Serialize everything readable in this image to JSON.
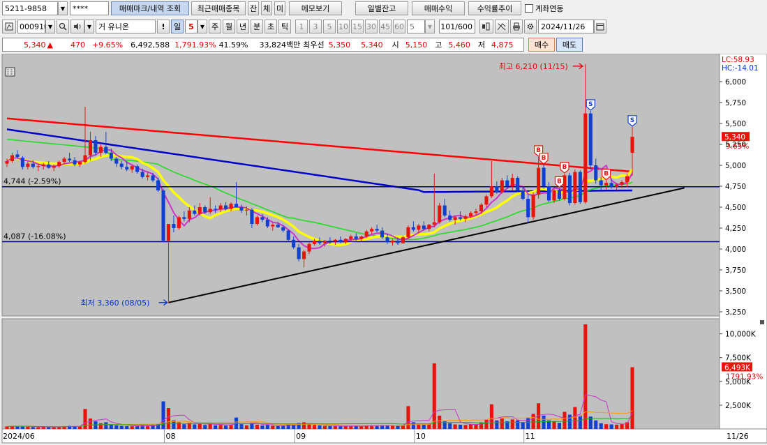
{
  "toolbar1": {
    "account": "5211-9858",
    "password": "****",
    "trade_mark_btn": "매매마크/내역 조회",
    "recent_items_btn": "최근매매종목",
    "btn_jan": "잔",
    "btn_che": "체",
    "btn_mi": "미",
    "memo_btn": "메모보기",
    "daily_balance_btn": "일별잔고",
    "trade_profit_btn": "매매수익",
    "return_trend_btn": "수익률추이",
    "account_link_label": "계좌연동"
  },
  "toolbar2": {
    "code": "000910",
    "market": "거",
    "name": "유니온",
    "period_buttons": [
      "일",
      "5",
      "주",
      "월",
      "년",
      "분",
      "초",
      "틱"
    ],
    "interval_buttons": [
      "1",
      "3",
      "5",
      "10",
      "15",
      "30",
      "45",
      "60"
    ],
    "interval_select": "5",
    "count": "101",
    "count_total": "/600",
    "date": "2024/11/26"
  },
  "quote": {
    "price": "5,340",
    "arrow": "▲",
    "change": "470",
    "change_pct": "+9.65%",
    "volume": "6,492,588",
    "volume_pct": "1,791.93%",
    "turnover": "41.59%",
    "amount": "33,824백만",
    "priority_label": "최우선",
    "ask": "5,350",
    "bid": "5,340",
    "open_label": "시",
    "open": "5,150",
    "high_label": "고",
    "high": "5,460",
    "low_label": "저",
    "low": "4,875",
    "buy_btn": "매수",
    "sell_btn": "매도"
  },
  "chart_labels": {
    "max_label": "최고 6,210 (11/15)",
    "min_label": "최저 3,360 (08/05)",
    "hline1": "4,744 (-2.59%)",
    "hline2": "4,087 (-16.08%)",
    "lc": "LC:58.93",
    "hc": "HC:-14.01",
    "cur_price_tag": "5,340",
    "cur_pct_tag": "9.65%",
    "vol_tag": "6,493K",
    "vol_pct_tag": "1791.93%",
    "x_end": "11/26"
  },
  "colors": {
    "up": "#e8140c",
    "down": "#1040d0",
    "ma_red": "#ff0000",
    "ma_blue": "#0000cc",
    "ma_green": "#22dd22",
    "ma_yellow": "#ffff00",
    "ma_magenta": "#cc33cc",
    "chart_bg": "#c0c0c0"
  },
  "chart_data": {
    "type": "candlestick",
    "title": "",
    "price_axis": [
      6000,
      5750,
      5500,
      5250,
      5000,
      4750,
      4500,
      4250,
      4000,
      3750,
      3500,
      3250
    ],
    "volume_axis": [
      "10,000K",
      "7,500K",
      "5,000K",
      "2,500K"
    ],
    "x_tick_labels": [
      "2024/06",
      "08",
      "09",
      "10",
      "11"
    ],
    "ylim": [
      3200,
      6300
    ],
    "volume_max": 11000,
    "candles": [
      [
        5020,
        5080,
        4980,
        5050,
        260
      ],
      [
        5050,
        5150,
        5030,
        5120,
        310
      ],
      [
        5130,
        5180,
        5080,
        5100,
        280
      ],
      [
        5090,
        5110,
        4950,
        4980,
        330
      ],
      [
        4980,
        5050,
        4950,
        5020,
        240
      ],
      [
        5020,
        5060,
        4960,
        4980,
        200
      ],
      [
        4980,
        5020,
        4930,
        4990,
        190
      ],
      [
        4990,
        5030,
        4950,
        5010,
        220
      ],
      [
        5010,
        5050,
        4960,
        4970,
        210
      ],
      [
        4970,
        5010,
        4930,
        4990,
        200
      ],
      [
        4990,
        5060,
        4970,
        5040,
        260
      ],
      [
        5040,
        5100,
        5010,
        5080,
        300
      ],
      [
        5080,
        5150,
        5040,
        5060,
        320
      ],
      [
        5060,
        5100,
        4990,
        5010,
        280
      ],
      [
        5010,
        5050,
        4980,
        5040,
        260
      ],
      [
        5040,
        5700,
        5020,
        5120,
        2100
      ],
      [
        5120,
        5400,
        5060,
        5300,
        1100
      ],
      [
        5300,
        5350,
        5120,
        5150,
        800
      ],
      [
        5150,
        5250,
        5100,
        5220,
        600
      ],
      [
        5220,
        5400,
        5130,
        5150,
        700
      ],
      [
        5150,
        5200,
        5050,
        5080,
        500
      ],
      [
        5080,
        5100,
        4980,
        5020,
        380
      ],
      [
        5020,
        5050,
        4950,
        4980,
        320
      ],
      [
        4980,
        5050,
        4930,
        4950,
        300
      ],
      [
        4950,
        5000,
        4910,
        4990,
        280
      ],
      [
        4990,
        5010,
        4900,
        4920,
        300
      ],
      [
        4920,
        4960,
        4840,
        4860,
        380
      ],
      [
        4860,
        4920,
        4820,
        4880,
        340
      ],
      [
        4880,
        4910,
        4800,
        4820,
        400
      ],
      [
        4820,
        4850,
        4680,
        4700,
        520
      ],
      [
        4700,
        4720,
        4080,
        4100,
        2900
      ],
      [
        4100,
        4300,
        3360,
        4300,
        2200
      ],
      [
        4300,
        4400,
        4200,
        4250,
        900
      ],
      [
        4250,
        4400,
        4230,
        4380,
        700
      ],
      [
        4380,
        4450,
        4330,
        4360,
        500
      ],
      [
        4360,
        4500,
        4320,
        4460,
        650
      ],
      [
        4460,
        4520,
        4400,
        4420,
        480
      ],
      [
        4420,
        4550,
        4400,
        4500,
        550
      ],
      [
        4500,
        4520,
        4420,
        4440,
        420
      ],
      [
        4440,
        4620,
        4420,
        4480,
        600
      ],
      [
        4480,
        4520,
        4430,
        4470,
        380
      ],
      [
        4470,
        4550,
        4440,
        4520,
        420
      ],
      [
        4520,
        4560,
        4460,
        4480,
        360
      ],
      [
        4480,
        4560,
        4450,
        4540,
        400
      ],
      [
        4540,
        4800,
        4500,
        4500,
        1200
      ],
      [
        4500,
        4530,
        4430,
        4460,
        500
      ],
      [
        4460,
        4510,
        4400,
        4470,
        380
      ],
      [
        4470,
        4490,
        4250,
        4300,
        650
      ],
      [
        4300,
        4400,
        4280,
        4380,
        450
      ],
      [
        4380,
        4420,
        4320,
        4350,
        360
      ],
      [
        4350,
        4380,
        4250,
        4270,
        420
      ],
      [
        4270,
        4310,
        4220,
        4290,
        330
      ],
      [
        4290,
        4320,
        4250,
        4260,
        300
      ],
      [
        4260,
        4280,
        4200,
        4220,
        340
      ],
      [
        4220,
        4230,
        4090,
        4110,
        520
      ],
      [
        4110,
        4150,
        4000,
        4020,
        480
      ],
      [
        4020,
        4060,
        3850,
        3880,
        620
      ],
      [
        3880,
        3990,
        3780,
        3970,
        700
      ],
      [
        3970,
        4080,
        3940,
        4060,
        520
      ],
      [
        4060,
        4120,
        4040,
        4100,
        420
      ],
      [
        4100,
        4140,
        4050,
        4070,
        380
      ],
      [
        4070,
        4110,
        4030,
        4100,
        340
      ],
      [
        4100,
        4140,
        4060,
        4090,
        300
      ],
      [
        4090,
        4120,
        4050,
        4110,
        290
      ],
      [
        4110,
        4150,
        4070,
        4080,
        280
      ],
      [
        4080,
        4130,
        4060,
        4120,
        300
      ],
      [
        4120,
        4170,
        4090,
        4150,
        320
      ],
      [
        4150,
        4190,
        4100,
        4120,
        300
      ],
      [
        4120,
        4160,
        4090,
        4150,
        280
      ],
      [
        4150,
        4230,
        4130,
        4210,
        350
      ],
      [
        4210,
        4260,
        4180,
        4240,
        380
      ],
      [
        4240,
        4290,
        4200,
        4220,
        360
      ],
      [
        4220,
        4260,
        4120,
        4140,
        420
      ],
      [
        4140,
        4180,
        4060,
        4080,
        380
      ],
      [
        4080,
        4120,
        4040,
        4100,
        320
      ],
      [
        4100,
        4140,
        4050,
        4070,
        300
      ],
      [
        4070,
        4160,
        4060,
        4140,
        380
      ],
      [
        4140,
        4280,
        4120,
        4260,
        2400
      ],
      [
        4260,
        4330,
        4210,
        4230,
        700
      ],
      [
        4230,
        4300,
        4190,
        4280,
        520
      ],
      [
        4280,
        4330,
        4220,
        4240,
        480
      ],
      [
        4240,
        4300,
        4210,
        4290,
        500
      ],
      [
        4290,
        4900,
        4260,
        4320,
        6900
      ],
      [
        4320,
        4550,
        4300,
        4520,
        1400
      ],
      [
        4520,
        4600,
        4380,
        4400,
        800
      ],
      [
        4400,
        4460,
        4330,
        4350,
        600
      ],
      [
        4350,
        4400,
        4290,
        4380,
        480
      ],
      [
        4380,
        4450,
        4340,
        4360,
        450
      ],
      [
        4360,
        4410,
        4320,
        4390,
        420
      ],
      [
        4390,
        4450,
        4370,
        4430,
        500
      ],
      [
        4430,
        4480,
        4400,
        4450,
        480
      ],
      [
        4450,
        4550,
        4420,
        4530,
        700
      ],
      [
        4530,
        4650,
        4500,
        4630,
        1000
      ],
      [
        4630,
        5050,
        4610,
        4750,
        2600
      ],
      [
        4750,
        4810,
        4660,
        4680,
        900
      ],
      [
        4680,
        4850,
        4660,
        4820,
        1100
      ],
      [
        4820,
        4880,
        4720,
        4750,
        800
      ],
      [
        4750,
        4900,
        4700,
        4850,
        1000
      ],
      [
        4850,
        4870,
        4680,
        4700,
        900
      ],
      [
        4700,
        4750,
        4580,
        4600,
        700
      ],
      [
        4600,
        4650,
        4320,
        4380,
        1200
      ],
      [
        4380,
        4680,
        4350,
        4650,
        1600
      ],
      [
        4650,
        5100,
        4600,
        4970,
        2700
      ],
      [
        4970,
        5010,
        4720,
        4750,
        1400
      ],
      [
        4750,
        4800,
        4560,
        4580,
        900
      ],
      [
        4580,
        4720,
        4550,
        4700,
        800
      ],
      [
        4700,
        4730,
        4580,
        4600,
        650
      ],
      [
        4600,
        4900,
        4580,
        4880,
        1800
      ],
      [
        4880,
        4910,
        4520,
        4550,
        1500
      ],
      [
        4550,
        4950,
        4530,
        4920,
        2300
      ],
      [
        4920,
        4940,
        4540,
        4560,
        1400
      ],
      [
        4560,
        6210,
        4540,
        5620,
        11000
      ],
      [
        5620,
        5650,
        4950,
        5000,
        1300
      ],
      [
        5000,
        5080,
        4780,
        4820,
        900
      ],
      [
        4820,
        4860,
        4700,
        4760,
        600
      ],
      [
        4760,
        4820,
        4710,
        4790,
        500
      ],
      [
        4790,
        4840,
        4720,
        4740,
        480
      ],
      [
        4740,
        4790,
        4700,
        4770,
        450
      ],
      [
        4770,
        4820,
        4730,
        4800,
        520
      ],
      [
        4800,
        4900,
        4740,
        4870,
        700
      ],
      [
        5150,
        5460,
        4875,
        5340,
        6493
      ]
    ],
    "annotations": {
      "max": {
        "price": 6210,
        "date": "11/15"
      },
      "min": {
        "price": 3360,
        "date": "08/05"
      },
      "hlines": [
        4744,
        4087
      ],
      "marks": [
        {
          "type": "S",
          "candle": 112
        },
        {
          "type": "S",
          "candle": 120
        },
        {
          "type": "B",
          "candle": 102
        },
        {
          "type": "B",
          "candle": 103
        },
        {
          "type": "B",
          "candle": 106
        },
        {
          "type": "B",
          "candle": 107
        },
        {
          "type": "B",
          "candle": 115
        }
      ],
      "trendline": [
        [
          31,
          3360
        ],
        [
          130,
          4730
        ]
      ]
    }
  }
}
